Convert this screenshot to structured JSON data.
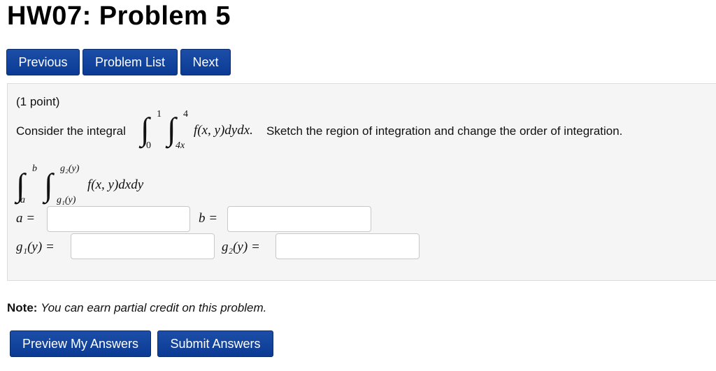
{
  "header": {
    "title": "HW07: Problem 5"
  },
  "nav": {
    "previous": "Previous",
    "problem_list": "Problem List",
    "next": "Next"
  },
  "problem": {
    "points": "(1 point)",
    "intro": "Consider the integral",
    "given": {
      "outer_upper": "1",
      "outer_lower": "0",
      "inner_upper": "4",
      "inner_lower": "4x",
      "integrand": "f(x, y)dydx."
    },
    "instruction": "Sketch the region of integration and change the order of integration.",
    "reversed": {
      "outer_upper": "b",
      "outer_lower": "a",
      "inner_upper": "g₂(y)",
      "inner_lower": "g₁(y)",
      "integrand": "f(x, y)dxdy"
    },
    "fields": {
      "a_label": "a =",
      "b_label": "b =",
      "g1_label": "g₁(y) =",
      "g2_label": "g₂(y) =",
      "a_value": "",
      "b_value": "",
      "g1_value": "",
      "g2_value": ""
    }
  },
  "note": {
    "label": "Note:",
    "text": "You can earn partial credit on this problem."
  },
  "actions": {
    "preview": "Preview My Answers",
    "submit": "Submit Answers"
  },
  "colors": {
    "button": "#0a3a94",
    "panel": "#f5f5f5"
  }
}
